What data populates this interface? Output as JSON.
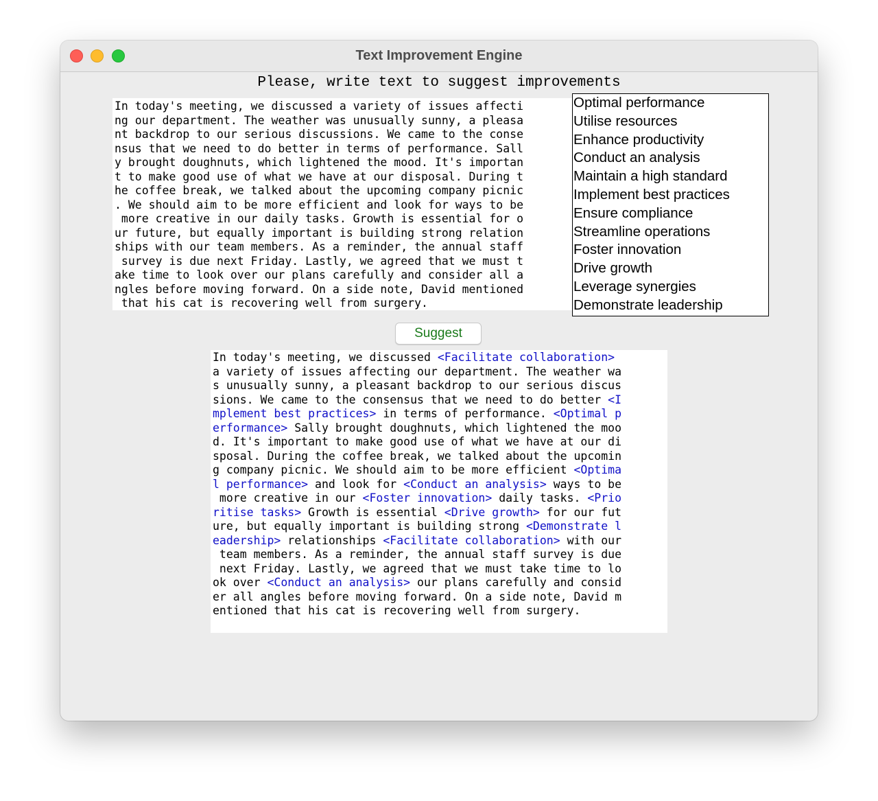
{
  "window": {
    "title": "Text Improvement Engine"
  },
  "prompt": "Please, write text to suggest improvements",
  "input_lines": [
    "In today's meeting, we discussed a variety of issues affecti",
    "ng our department. The weather was unusually sunny, a pleasa",
    "nt backdrop to our serious discussions. We came to the conse",
    "nsus that we need to do better in terms of performance. Sall",
    "y brought doughnuts, which lightened the mood. It's importan",
    "t to make good use of what we have at our disposal. During t",
    "he coffee break, we talked about the upcoming company picnic",
    ". We should aim to be more efficient and look for ways to be",
    " more creative in our daily tasks. Growth is essential for o",
    "ur future, but equally important is building strong relation",
    "ships with our team members. As a reminder, the annual staff",
    " survey is due next Friday. Lastly, we agreed that we must t",
    "ake time to look over our plans carefully and consider all a",
    "ngles before moving forward. On a side note, David mentioned",
    " that his cat is recovering well from surgery."
  ],
  "suggestions": [
    "Optimal performance",
    "Utilise resources",
    "Enhance productivity",
    "Conduct an analysis",
    "Maintain a high standard",
    "Implement best practices",
    "Ensure compliance",
    "Streamline operations",
    "Foster innovation",
    "Drive growth",
    "Leverage synergies",
    "Demonstrate leadership"
  ],
  "suggest_button": "Suggest",
  "output_lines": [
    [
      {
        "t": "In today's meeting, we discussed "
      },
      {
        "t": "<Facilitate collaboration>",
        "hl": true
      },
      {
        "t": " "
      }
    ],
    [
      {
        "t": "a variety of issues affecting our department. The weather wa"
      }
    ],
    [
      {
        "t": "s unusually sunny, a pleasant backdrop to our serious discus"
      }
    ],
    [
      {
        "t": "sions. We came to the consensus that we need to do better "
      },
      {
        "t": "<I",
        "hl": true
      }
    ],
    [
      {
        "t": "mplement best practices>",
        "hl": true
      },
      {
        "t": " in terms of performance. "
      },
      {
        "t": "<Optimal p",
        "hl": true
      }
    ],
    [
      {
        "t": "erformance>",
        "hl": true
      },
      {
        "t": " Sally brought doughnuts, which lightened the moo"
      }
    ],
    [
      {
        "t": "d. It's important to make good use of what we have at our di"
      }
    ],
    [
      {
        "t": "sposal. During the coffee break, we talked about the upcomin"
      }
    ],
    [
      {
        "t": "g company picnic. We should aim to be more efficient "
      },
      {
        "t": "<Optima",
        "hl": true
      }
    ],
    [
      {
        "t": "l performance>",
        "hl": true
      },
      {
        "t": " and look for "
      },
      {
        "t": "<Conduct an analysis>",
        "hl": true
      },
      {
        "t": " ways to be"
      }
    ],
    [
      {
        "t": " more creative in our "
      },
      {
        "t": "<Foster innovation>",
        "hl": true
      },
      {
        "t": " daily tasks. "
      },
      {
        "t": "<Prio",
        "hl": true
      }
    ],
    [
      {
        "t": "ritise tasks>",
        "hl": true
      },
      {
        "t": " Growth is essential "
      },
      {
        "t": "<Drive growth>",
        "hl": true
      },
      {
        "t": " for our fut"
      }
    ],
    [
      {
        "t": "ure, but equally important is building strong "
      },
      {
        "t": "<Demonstrate l",
        "hl": true
      }
    ],
    [
      {
        "t": "eadership>",
        "hl": true
      },
      {
        "t": " relationships "
      },
      {
        "t": "<Facilitate collaboration>",
        "hl": true
      },
      {
        "t": " with our"
      }
    ],
    [
      {
        "t": " team members. As a reminder, the annual staff survey is due"
      }
    ],
    [
      {
        "t": " next Friday. Lastly, we agreed that we must take time to lo"
      }
    ],
    [
      {
        "t": "ok over "
      },
      {
        "t": "<Conduct an analysis>",
        "hl": true
      },
      {
        "t": " our plans carefully and consid"
      }
    ],
    [
      {
        "t": "er all angles before moving forward. On a side note, David m"
      }
    ],
    [
      {
        "t": "entioned that his cat is recovering well from surgery."
      }
    ]
  ],
  "colors": {
    "highlight": "#1010c8",
    "button_text": "#1a7a1a",
    "close": "#fe5f57",
    "minimize": "#febc2e",
    "maximize": "#28c840"
  }
}
